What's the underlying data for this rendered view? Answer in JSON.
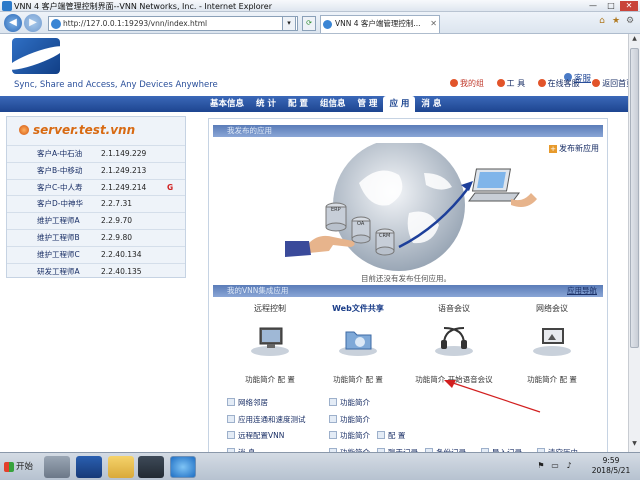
{
  "window": {
    "title": "VNN 4 客户端管理控制界面--VNN Networks, Inc. - Internet Explorer",
    "url": "http://127.0.0.1:19293/vnn/index.html",
    "tab_title": "VNN 4 客户端管理控制...",
    "minimize": "—",
    "maximize": "□",
    "close": "✕"
  },
  "header": {
    "help_label": "客服",
    "slogan": "Sync, Share and Access, Any Devices Anywhere",
    "links": [
      {
        "label": "我的组",
        "color": "#e2542a"
      },
      {
        "label": "工 具",
        "color": "#e2542a"
      },
      {
        "label": "在线客服",
        "color": "#e2542a"
      },
      {
        "label": "返回首页",
        "color": "#e2542a"
      }
    ]
  },
  "nav": {
    "tabs": [
      "基本信息",
      "统 计",
      "配 置",
      "组信息",
      "管 理",
      "应 用",
      "消 息"
    ],
    "active_index": 5
  },
  "sidebar": {
    "server": "server.test.vnn",
    "clients": [
      {
        "name": "客户A-中石油",
        "ip": "2.1.149.229",
        "mark": ""
      },
      {
        "name": "客户B-中移动",
        "ip": "2.1.249.213",
        "mark": ""
      },
      {
        "name": "客户C-中人寿",
        "ip": "2.1.249.214",
        "mark": "G"
      },
      {
        "name": "客户D-中神华",
        "ip": "2.2.7.31",
        "mark": ""
      },
      {
        "name": "维护工程师A",
        "ip": "2.2.9.70",
        "mark": ""
      },
      {
        "name": "维护工程师B",
        "ip": "2.2.9.80",
        "mark": ""
      },
      {
        "name": "维护工程师C",
        "ip": "2.2.40.134",
        "mark": ""
      },
      {
        "name": "研发工程师A",
        "ip": "2.2.40.135",
        "mark": ""
      }
    ]
  },
  "main": {
    "published_header": "我发布的应用",
    "add_app": "发布新应用",
    "no_published": "目前还没有发布任何应用。",
    "vnn_header": "我的VNN集成应用",
    "app_guide": "应用导航",
    "apps": [
      {
        "name": "远程控制",
        "links": "功能简介  配 置"
      },
      {
        "name": "Web文件共享",
        "links": "功能简介  配 置"
      },
      {
        "name": "语音会议",
        "links": "功能简介  开始语音会议"
      },
      {
        "name": "网络会议",
        "links": "功能简介  配 置"
      }
    ],
    "rows": [
      {
        "left": "网络邻居",
        "mid": "功能简介",
        "extra": [
          "",
          "",
          "",
          ""
        ]
      },
      {
        "left": "应用连通和速度测试",
        "mid": "功能简介",
        "extra": [
          "",
          "",
          "",
          ""
        ]
      },
      {
        "left": "远程配置VNN",
        "mid": "功能简介",
        "extra": [
          "配 置",
          "",
          "",
          ""
        ]
      },
      {
        "left": "消 息",
        "mid": "功能简介",
        "extra": [
          "聊天记录",
          "备份记录",
          "导入记录",
          "清空历史"
        ]
      }
    ],
    "illus_labels": [
      "ERP",
      "OA",
      "CRM"
    ]
  },
  "taskbar": {
    "start": "开始",
    "time": "9:59",
    "date": "2018/5/21"
  }
}
